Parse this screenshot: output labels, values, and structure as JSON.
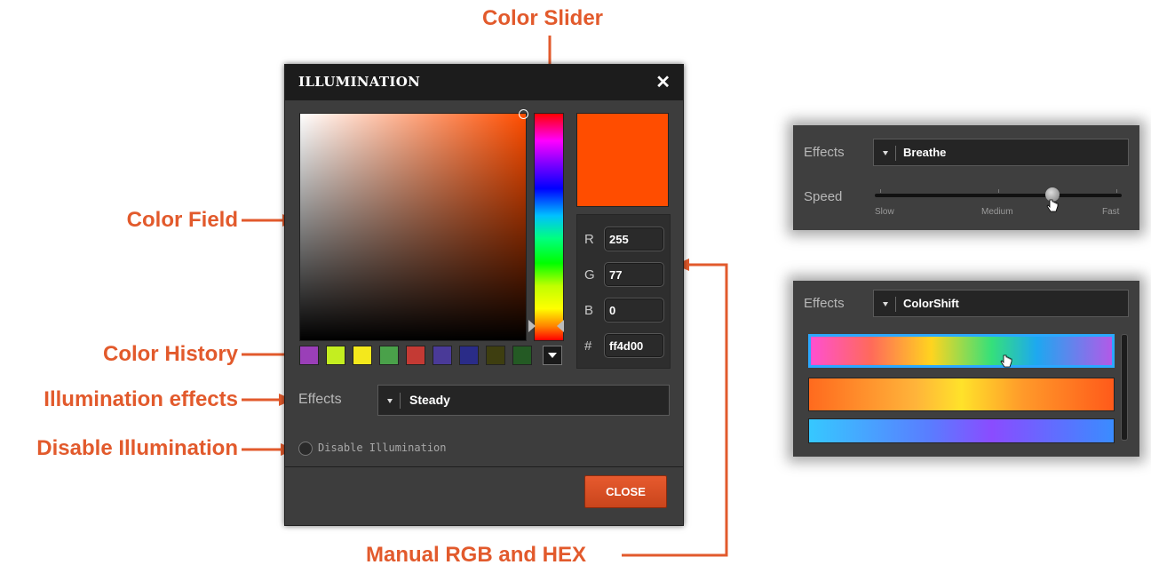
{
  "callouts": {
    "color_slider": "Color Slider",
    "color_field": "Color Field",
    "color_history": "Color History",
    "illumination_effects": "Illumination effects",
    "disable_illumination": "Disable Illumination",
    "manual_rgb_hex": "Manual RGB and HEX"
  },
  "dialog": {
    "title": "ILLUMINATION",
    "close_icon": "close-icon",
    "rgb": {
      "r_label": "R",
      "r_value": "255",
      "g_label": "G",
      "g_value": "77",
      "b_label": "B",
      "b_value": "0",
      "hex_label": "#",
      "hex_value": "ff4d00"
    },
    "preview_color": "#ff4d00",
    "history_colors": [
      "#9a3fb8",
      "#c4ee20",
      "#f4e81c",
      "#4aa14a",
      "#c43a34",
      "#4a3a98",
      "#2a2c88",
      "#3e3e10",
      "#245a24"
    ],
    "effects_label": "Effects",
    "effects_value": "Steady",
    "disable_label": "Disable Illumination",
    "close_button": "CLOSE"
  },
  "panel_breathe": {
    "effects_label": "Effects",
    "effects_value": "Breathe",
    "speed_label": "Speed",
    "speed_slow": "Slow",
    "speed_medium": "Medium",
    "speed_fast": "Fast",
    "speed_value_fraction": 0.72
  },
  "panel_colorshift": {
    "effects_label": "Effects",
    "effects_value": "ColorShift"
  }
}
